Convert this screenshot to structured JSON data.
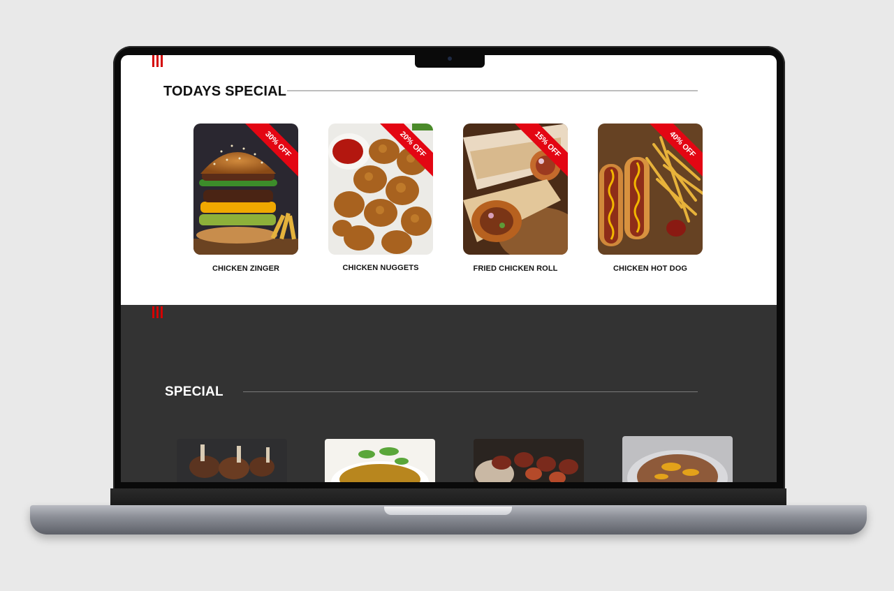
{
  "todays_special": {
    "title": "TODAYS SPECIAL",
    "items": [
      {
        "name": "CHICKEN ZINGER",
        "discount": "30% OFF",
        "image_icon": "burger-image"
      },
      {
        "name": "CHICKEN NUGGETS",
        "discount": "20% OFF",
        "image_icon": "nuggets-image"
      },
      {
        "name": "FRIED CHICKEN ROLL",
        "discount": "15% OFF",
        "image_icon": "roll-image"
      },
      {
        "name": "CHICKEN HOT DOG",
        "discount": "40% OFF",
        "image_icon": "hotdog-image"
      }
    ]
  },
  "special": {
    "title": "SPECIAL",
    "thumbs": [
      "lamb-chops-image",
      "biryani-image",
      "kebab-image",
      "dessert-image"
    ]
  },
  "colors": {
    "accent": "#d40000",
    "dark_section": "#333333",
    "ribbon": "#e30613"
  }
}
